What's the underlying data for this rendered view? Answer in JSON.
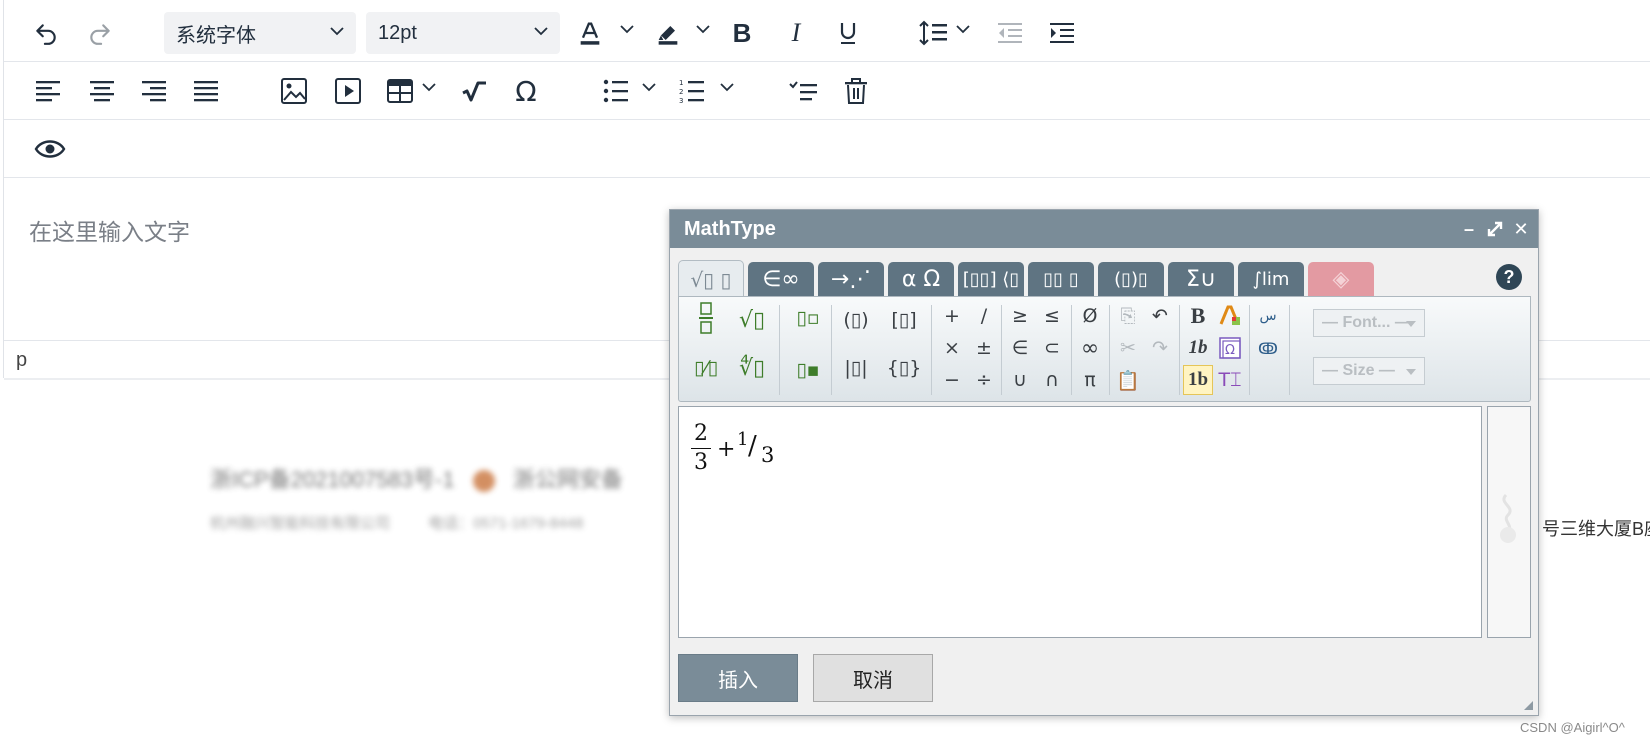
{
  "toolbar": {
    "font_family": "系统字体",
    "font_size": "12pt"
  },
  "editor": {
    "placeholder": "在这里输入文字",
    "status_path": "p"
  },
  "footer": {
    "line1": "浙ICP备2021007583号-1",
    "police": "浙公网安备",
    "line2_company": "杭州融兴智能科技有限公司",
    "line2_phone": "电话：0571-1679-8448",
    "address_tail": "号三维大厦B座"
  },
  "watermark": "CSDN @Aigirl^O^",
  "mathtype": {
    "title": "MathType",
    "tabs": [
      "√▯ ▯",
      "∈∞",
      "→⋰",
      "α Ω",
      "[▯▯] ⟨▯",
      "▯▯ ▯",
      "(▯)▯",
      "Σ∪",
      "∫lim",
      "◈"
    ],
    "help": "?",
    "palette": {
      "font_select": "— Font... —",
      "size_select": "— Size —"
    },
    "formula": {
      "frac_num": "2",
      "frac_den": "3",
      "op": "+",
      "bev_num": "1",
      "bev_slash": "/",
      "bev_den": "3"
    },
    "insert_label": "插入",
    "cancel_label": "取消"
  }
}
